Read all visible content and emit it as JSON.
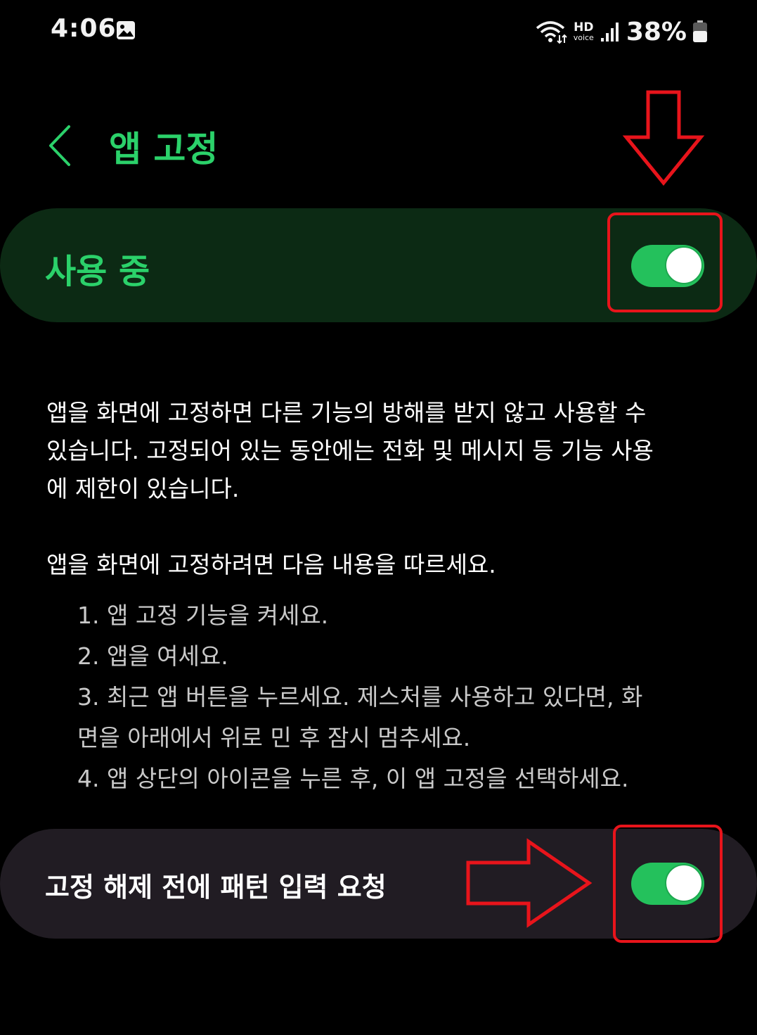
{
  "status_bar": {
    "time": "4:06",
    "hd_top": "HD",
    "hd_bottom": "voice",
    "battery": "38%",
    "icons": [
      "gallery-icon",
      "wifi-icon",
      "hd-voice-icon",
      "signal-icon",
      "battery-icon"
    ]
  },
  "header": {
    "title": "앱 고정",
    "back_icon": "chevron-left-icon"
  },
  "master_switch": {
    "label": "사용 중",
    "enabled": true
  },
  "description": {
    "line1": "앱을 화면에 고정하면 다른 기능의 방해를 받지 않고 사용할 수",
    "line2": "있습니다. 고정되어 있는 동안에는 전화 및 메시지 등 기능 사용",
    "line3": "에 제한이 있습니다."
  },
  "instructions": {
    "heading": "앱을 화면에 고정하려면 다음 내용을 따르세요.",
    "steps": [
      "1. 앱 고정 기능을 켜세요.",
      "2. 앱을 여세요.",
      "3. 최근 앱 버튼을 누르세요. 제스처를 사용하고 있다면, 화",
      "면을 아래에서 위로 민 후 잠시 멈추세요.",
      "4. 앱 상단의 아이콘을 누른 후, 이 앱 고정을 선택하세요."
    ]
  },
  "pattern_setting": {
    "label": "고정 해제 전에 패턴 입력 요청",
    "enabled": true
  },
  "colors": {
    "accent": "#2bd16a",
    "toggle_on": "#24c15c",
    "master_row_bg": "#0c2a14",
    "setting_row_bg": "#211c23",
    "annotation_red": "#e8141b"
  }
}
